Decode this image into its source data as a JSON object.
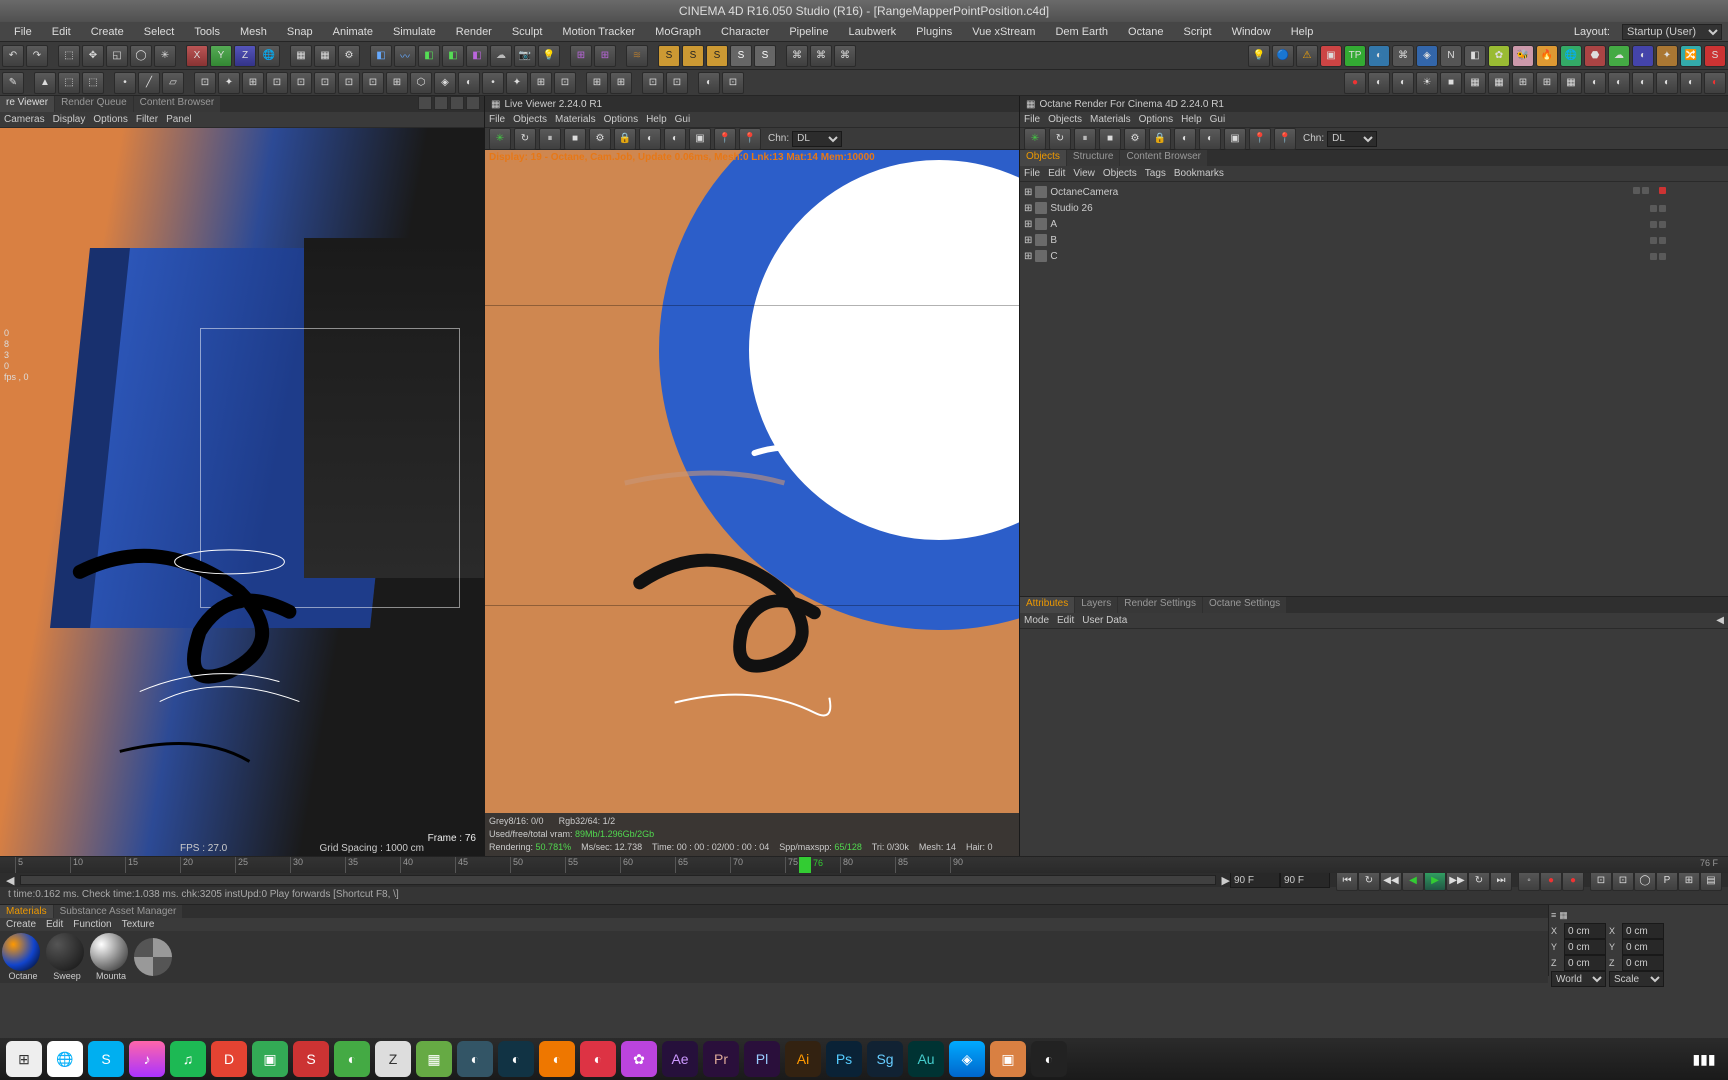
{
  "title": "CINEMA 4D R16.050 Studio (R16) - [RangeMapperPointPosition.c4d]",
  "menus": [
    "File",
    "Edit",
    "Create",
    "Select",
    "Tools",
    "Mesh",
    "Snap",
    "Animate",
    "Simulate",
    "Render",
    "Sculpt",
    "Motion Tracker",
    "MoGraph",
    "Character",
    "Pipeline",
    "Laubwerk",
    "Plugins",
    "Vue xStream",
    "Dem Earth",
    "Octane",
    "Script",
    "Window",
    "Help"
  ],
  "layout": {
    "label": "Layout:",
    "value": "Startup (User)"
  },
  "left_panel": {
    "tabs": [
      "re Viewer",
      "Render Queue",
      "Content Browser"
    ],
    "sub": [
      "Cameras",
      "Display",
      "Options",
      "Filter",
      "Panel"
    ],
    "frame": "Frame : 76",
    "fps": "FPS : 27.0",
    "grid": "Grid Spacing : 1000 cm",
    "axis": [
      "0",
      "8",
      "3",
      "0",
      "fps , 0"
    ]
  },
  "center_panel": {
    "title": "Live Viewer 2.24.0 R1",
    "menus": [
      "File",
      "Objects",
      "Materials",
      "Options",
      "Help",
      "Gui"
    ],
    "chn": "Chn:",
    "chn_val": "DL",
    "overlay": "Display: 19 - Octane, Cam.Job, Update 0.06ms, Mesh:0 Lnk:13 Mat:14 Mem:10000",
    "s1": {
      "a": "Grey8/16:",
      "av": "0/0",
      "b": "Rgb32/64:",
      "bv": "1/2"
    },
    "s2": {
      "a": "Used/free/total vram:",
      "av": "89Mb/1.296Gb/2Gb"
    },
    "s3": {
      "a": "Rendering:",
      "av": "50.781%",
      "b": "Ms/sec:",
      "bv": "12.738",
      "c": "Time:",
      "cv": "00 : 00 : 02/00 : 00 : 04",
      "d": "Spp/maxspp:",
      "dv": "65/128",
      "e": "Tri: 0/30k",
      "f": "Mesh: 14",
      "g": "Hair: 0"
    }
  },
  "right_panel": {
    "title": "Octane Render For Cinema 4D 2.24.0 R1",
    "menus": [
      "File",
      "Objects",
      "Materials",
      "Options",
      "Help",
      "Gui"
    ],
    "obj_tabs": [
      "Objects",
      "Structure",
      "Content Browser"
    ],
    "obj_menu": [
      "File",
      "Edit",
      "View",
      "Objects",
      "Tags",
      "Bookmarks"
    ],
    "tree": [
      {
        "name": "OctaneCamera",
        "icon": "camera",
        "red": true
      },
      {
        "name": "Studio 26",
        "icon": "layer"
      },
      {
        "name": "A",
        "icon": "layer"
      },
      {
        "name": "B",
        "icon": "layer"
      },
      {
        "name": "C",
        "icon": "layer"
      }
    ],
    "attr_tabs": [
      "Attributes",
      "Layers",
      "Render Settings",
      "Octane Settings"
    ],
    "attr_menu": [
      "Mode",
      "Edit",
      "User Data"
    ],
    "chn": "Chn:",
    "chn_val": "DL"
  },
  "timeline": {
    "ticks": [
      "5",
      "10",
      "15",
      "20",
      "25",
      "30",
      "35",
      "40",
      "45",
      "50",
      "55",
      "60",
      "65",
      "70",
      "75",
      "80",
      "85",
      "90"
    ],
    "current": "76 F",
    "end": "90 F",
    "val": "76"
  },
  "materials": {
    "tabs": [
      "Materials",
      "Substance Asset Manager"
    ],
    "menu": [
      "Create",
      "Edit",
      "Function",
      "Texture"
    ],
    "items": [
      "Octane",
      "Sweep",
      "Mounta",
      ""
    ]
  },
  "coords": {
    "rows": [
      {
        "l": "X",
        "v": "0 cm",
        "l2": "X",
        "v2": "0 cm"
      },
      {
        "l": "Y",
        "v": "0 cm",
        "l2": "Y",
        "v2": "0 cm"
      },
      {
        "l": "Z",
        "v": "0 cm",
        "l2": "Z",
        "v2": "0 cm"
      }
    ],
    "world": "World",
    "scale": "Scale"
  },
  "statusbar": "t time:0.162 ms.  Check time:1.038 ms.  chk:3205  instUpd:0     Play forwards [Shortcut F8, \\]",
  "taskbar_apps": [
    "apps",
    "chrome",
    "skype",
    "itunes",
    "spotify",
    "todoist",
    "finder",
    "ever",
    "safari",
    "zbrush",
    "brush",
    "c4d",
    "maxon",
    "sub",
    "swap",
    "rdio",
    "ae",
    "pr",
    "pl",
    "ai",
    "ps",
    "sg",
    "au",
    "kn",
    "c4d2",
    "oct"
  ]
}
